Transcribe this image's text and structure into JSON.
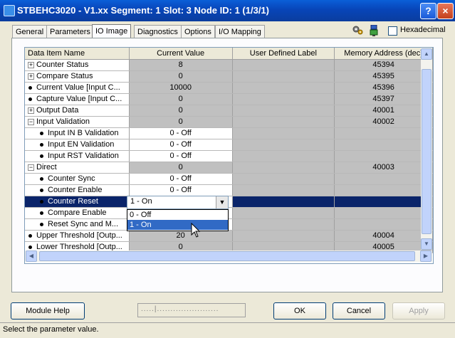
{
  "window": {
    "title": "STBEHC3020 - V1.xx Segment: 1 Slot: 3 Node ID: 1 (1/3/1)",
    "help_label": "?",
    "close_label": "×"
  },
  "tabs": [
    {
      "label": "General",
      "active": false
    },
    {
      "label": "Parameters",
      "active": false
    },
    {
      "label": "IO Image",
      "active": true
    },
    {
      "label": "Diagnostics",
      "active": false
    },
    {
      "label": "Options",
      "active": false
    },
    {
      "label": "I/O Mapping",
      "active": false
    }
  ],
  "toolbar": {
    "hexadecimal_label": "Hexadecimal",
    "hexadecimal_checked": false
  },
  "grid": {
    "columns": [
      "Data Item Name",
      "Current Value",
      "User Defined Label",
      "Memory Address (dec)"
    ],
    "rows": [
      {
        "name": "Counter Status",
        "value": "8",
        "label": "",
        "address": "45394",
        "icon": "expand",
        "level": 0
      },
      {
        "name": "Compare Status",
        "value": "0",
        "label": "",
        "address": "45395",
        "icon": "expand",
        "level": 0
      },
      {
        "name": "Current Value [Input C...",
        "value": "10000",
        "label": "",
        "address": "45396",
        "icon": "bullet",
        "level": 0
      },
      {
        "name": "Capture Value [Input C...",
        "value": "0",
        "label": "",
        "address": "45397",
        "icon": "bullet",
        "level": 0
      },
      {
        "name": "Output Data",
        "value": "0",
        "label": "",
        "address": "40001",
        "icon": "expand",
        "level": 0
      },
      {
        "name": "Input Validation",
        "value": "0",
        "label": "",
        "address": "40002",
        "icon": "collapse",
        "level": 0
      },
      {
        "name": "Input IN B Validation",
        "value": "0 - Off",
        "label": "",
        "address": "",
        "icon": "bullet",
        "level": 1
      },
      {
        "name": "Input EN Validation",
        "value": "0 - Off",
        "label": "",
        "address": "",
        "icon": "bullet",
        "level": 1
      },
      {
        "name": "Input RST Validation",
        "value": "0 - Off",
        "label": "",
        "address": "",
        "icon": "bullet",
        "level": 1
      },
      {
        "name": "Direct",
        "value": "0",
        "label": "",
        "address": "40003",
        "icon": "collapse",
        "level": 0
      },
      {
        "name": "Counter Sync",
        "value": "0 - Off",
        "label": "",
        "address": "",
        "icon": "bullet",
        "level": 1
      },
      {
        "name": "Counter Enable",
        "value": "0 - Off",
        "label": "",
        "address": "",
        "icon": "bullet",
        "level": 1
      },
      {
        "name": "Counter Reset",
        "value": "",
        "label": "",
        "address": "",
        "icon": "bullet",
        "level": 1,
        "selected": true
      },
      {
        "name": "Compare Enable",
        "value": "",
        "label": "",
        "address": "",
        "icon": "bullet",
        "level": 1
      },
      {
        "name": "Reset Sync and M...",
        "value": "",
        "label": "",
        "address": "",
        "icon": "bullet",
        "level": 1
      },
      {
        "name": "Upper Threshold [Outp...",
        "value": "20",
        "label": "",
        "address": "40004",
        "icon": "bullet",
        "level": 0
      },
      {
        "name": "Lower Threshold [Outp...",
        "value": "0",
        "label": "",
        "address": "40005",
        "icon": "bullet",
        "level": 0
      }
    ]
  },
  "editor": {
    "combo_value": "1 - On",
    "combo_arrow": "▼",
    "options": [
      "0 - Off",
      "1 - On"
    ],
    "selected_option": 1
  },
  "scroll": {
    "up": "▲",
    "down": "▼",
    "left": "◀",
    "right": "▶"
  },
  "footer": {
    "module_help": "Module Help",
    "progress_text": ".....|.......................",
    "ok": "OK",
    "cancel": "Cancel",
    "apply": "Apply"
  },
  "status": {
    "text": "Select the parameter value."
  }
}
